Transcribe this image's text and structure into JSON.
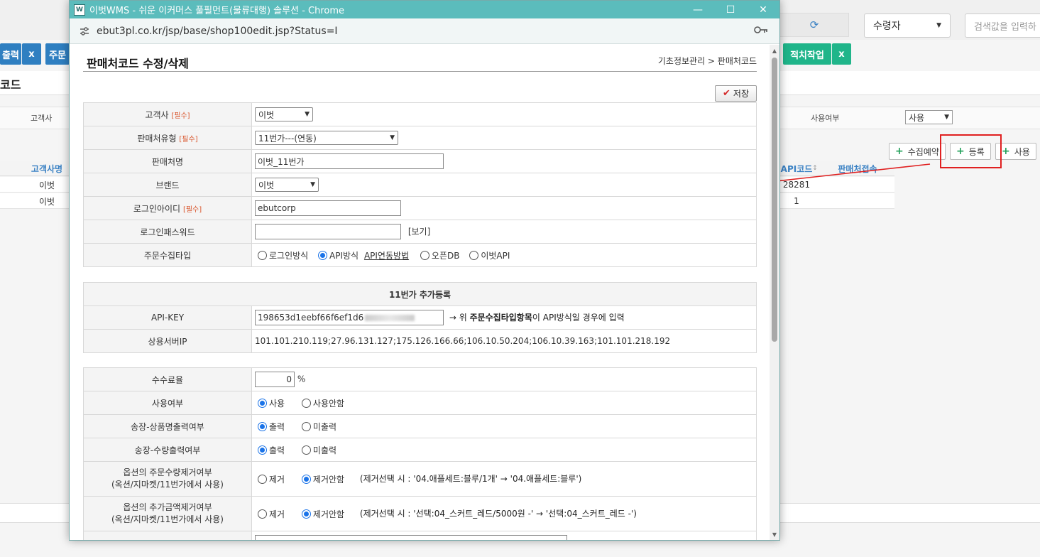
{
  "background": {
    "select_value": "수령자",
    "search_placeholder": "검색값을 입력하",
    "btn_output": "출력",
    "btn_x1": "x",
    "btn_order": "주문",
    "btn_stack": "적치작업",
    "btn_x2": "x",
    "page_title": "코드",
    "filter_customer_label": "고객사",
    "filter_use_label": "사용여부",
    "filter_use_value": "사용",
    "buttons": {
      "collect": "수집예약",
      "register": "등록",
      "use": "사용"
    },
    "grid": {
      "head_customer": "고객사명",
      "head_api": "API코드",
      "head_api_sort": "↕",
      "head_connect": "판매처접속",
      "rows": [
        {
          "customer": "이벗",
          "api": "28281"
        },
        {
          "customer": "이벗",
          "api": "1"
        }
      ]
    }
  },
  "window": {
    "title": "이벗WMS - 쉬운 이커머스 풀필먼트(물류대행) 솔루션 - Chrome",
    "url": "ebut3pl.co.kr/jsp/base/shop100edit.jsp?Status=I",
    "logo_text": "W"
  },
  "page": {
    "title": "판매처코드 수정/삭제",
    "breadcrumb": "기초정보관리 > 판매처코드",
    "save_label": "저장",
    "required_tag": "[필수]"
  },
  "form": {
    "customer_label": "고객사",
    "customer_value": "이벗",
    "shop_type_label": "판매처유형",
    "shop_type_value": "11번가---(연동)",
    "shop_name_label": "판매처명",
    "shop_name_value": "이벗_11번가",
    "brand_label": "브랜드",
    "brand_value": "이벗",
    "login_id_label": "로그인아이디",
    "login_id_value": "ebutcorp",
    "login_pw_label": "로그인패스워드",
    "login_pw_value": "",
    "view_label": "[보기]",
    "collect_type_label": "주문수집타입",
    "collect_options": [
      "로그인방식",
      "API방식",
      "API연동방법",
      "오픈DB",
      "이벗API"
    ]
  },
  "extra": {
    "section_title": "11번가 추가등록",
    "api_key_label": "API-KEY",
    "api_key_value": "198653d1eebf66f6ef1d6",
    "api_key_hint_prefix": "→ 위 ",
    "api_key_hint_bold": "주문수집타입항목",
    "api_key_hint_suffix": "이 API방식일 경우에 입력",
    "server_ip_label": "상용서버IP",
    "server_ip_value": "101.101.210.119;27.96.131.127;175.126.166.66;106.10.50.204;106.10.39.163;101.101.218.192"
  },
  "settings": {
    "fee_label": "수수료율",
    "fee_value": "0",
    "fee_unit": "%",
    "use_label": "사용여부",
    "use_on": "사용",
    "use_off": "사용안함",
    "invoice_name_label": "송장-상품명출력여부",
    "invoice_qty_label": "송장-수량출력여부",
    "print_on": "출력",
    "print_off": "미출력",
    "opt_qty_label_1": "옵션의 주문수량제거여부",
    "opt_qty_label_2": "(옥션/지마켓/11번가에서 사용)",
    "opt_amt_label_1": "옵션의 추가금액제거여부",
    "opt_amt_label_2": "(옥션/지마켓/11번가에서 사용)",
    "remove": "제거",
    "no_remove": "제거안함",
    "opt_qty_hint": "(제거선택 시 : '04.애플세트:블루/1개' → '04.애플세트:블루')",
    "opt_amt_hint": "(제거선택 시 : '선택:04_스커트_레드/5000원 -' → '선택:04_스커트_레드 -')"
  },
  "colors": {
    "titlebar": "#5bbcbc",
    "accent_blue": "#2f7fc1",
    "accent_teal": "#20b58a",
    "radio_on": "#1a73e8",
    "annotation_red": "#e02020"
  }
}
